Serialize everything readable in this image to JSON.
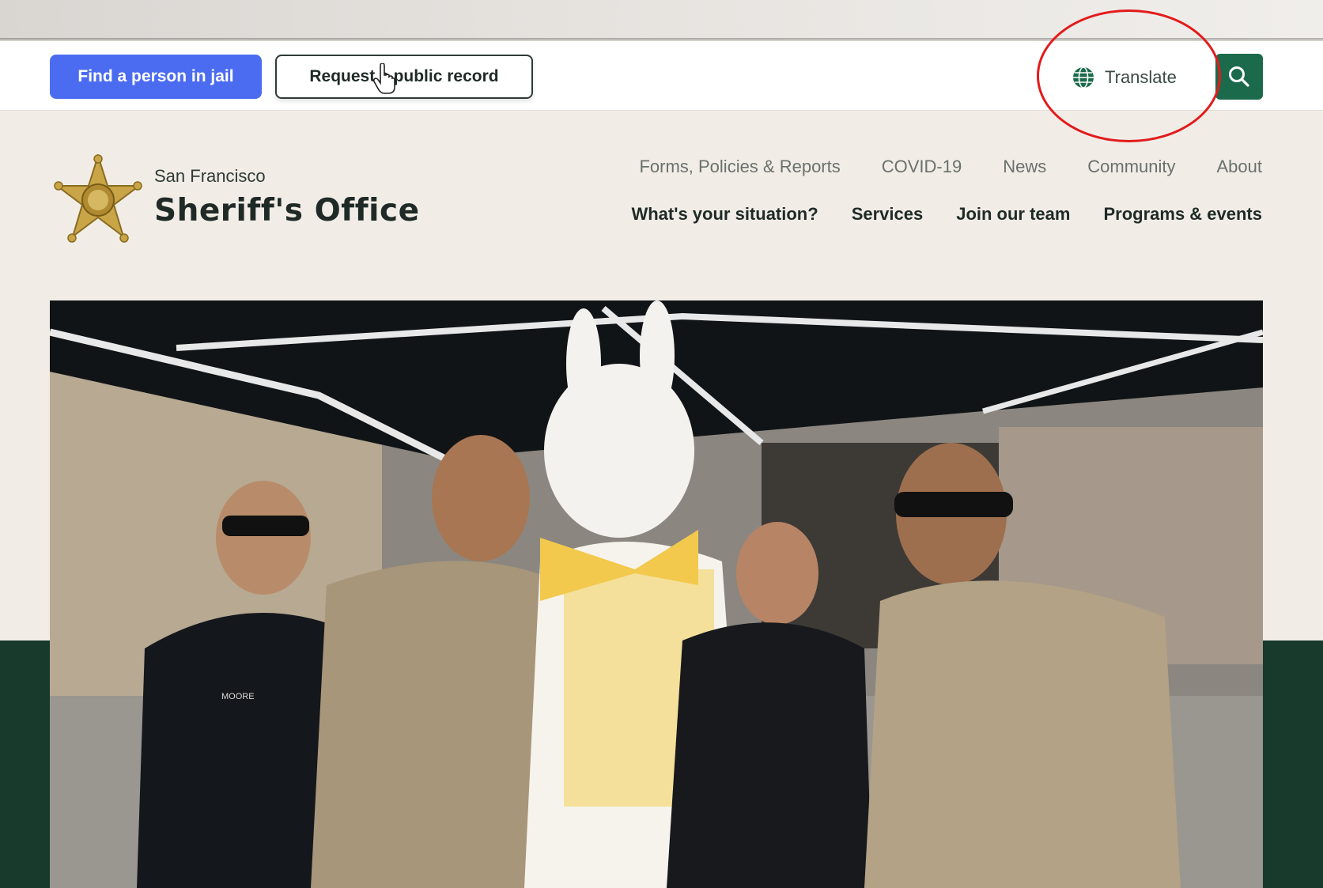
{
  "utility": {
    "find_person_label": "Find a person in jail",
    "request_record_label": "Request a public record",
    "translate_label": "Translate",
    "search_icon": "search-icon",
    "globe_icon": "globe-icon"
  },
  "header": {
    "city": "San Francisco",
    "office": "Sheriff's Office",
    "logo": "sheriff-star-badge"
  },
  "nav": {
    "secondary": [
      "Forms, Policies & Reports",
      "COVID-19",
      "News",
      "Community",
      "About"
    ],
    "primary": [
      "What's your situation?",
      "Services",
      "Join our team",
      "Programs & events"
    ]
  },
  "hero": {
    "photo_text": "MOORE"
  },
  "colors": {
    "primary_button": "#4b6cf1",
    "search_button": "#1c6a4c",
    "hero_band": "#183a2c",
    "page_bg": "#f1ede6",
    "annotation": "#e21b1b"
  }
}
